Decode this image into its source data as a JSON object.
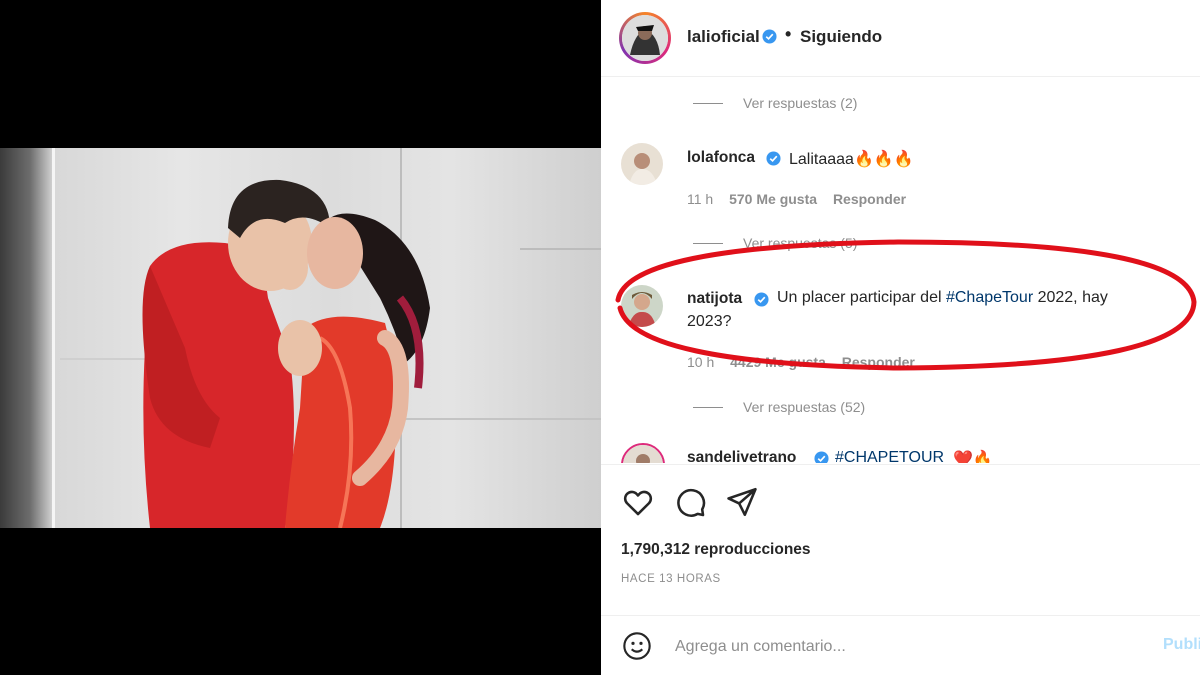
{
  "post": {
    "owner": {
      "username": "lalioficial",
      "follow_status": "Siguiendo",
      "separator": "•"
    },
    "comments": [
      {
        "view_replies": "Ver respuestas (2)"
      },
      {
        "username": "lolafonca",
        "text": "Lalitaaaa🔥🔥🔥",
        "time": "11 h",
        "likes": "570 Me gusta",
        "reply": "Responder",
        "view_replies": "Ver respuestas (5)"
      },
      {
        "username": "natijota",
        "text_line1": "Un placer participar del ",
        "hashtag": "#ChapeTour",
        "text_line1_end": " 2022, hay",
        "text_line2": "2023?",
        "time": "10 h",
        "likes": "4429 Me gusta",
        "reply": "Responder",
        "view_replies": "Ver respuestas (52)"
      },
      {
        "username": "sandelivetrano",
        "hashtag": "#CHAPETOUR",
        "emoji": "❤️🔥"
      }
    ],
    "views": "1,790,312 reproducciones",
    "time_ago": "HACE 13 HORAS",
    "comment_box": {
      "placeholder": "Agrega un comentario...",
      "publish": "Publicar"
    }
  },
  "icons": [
    "heart-icon",
    "comment-icon",
    "share-icon",
    "emoji-icon",
    "verified-icon"
  ],
  "colors": {
    "link": "#00376b",
    "verified": "#3897f0",
    "highlight": "#e0101a",
    "publish": "#b2dffc"
  }
}
